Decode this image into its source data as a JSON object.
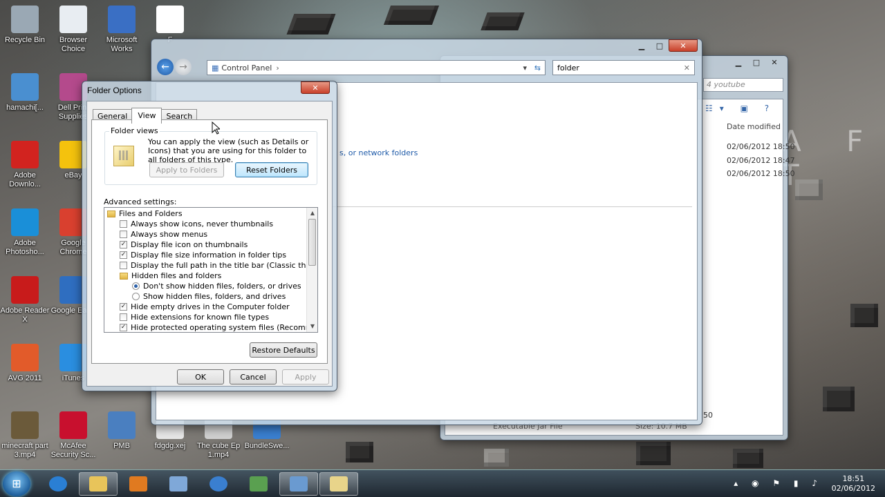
{
  "desktop_icons": [
    {
      "label": "Recycle Bin",
      "icon": "recycle-bin-icon",
      "color": "#9aa8b4"
    },
    {
      "label": "Browser Choice",
      "icon": "checklist-icon",
      "color": "#e8edf2"
    },
    {
      "label": "Microsoft Works",
      "icon": "works-icon",
      "color": "#3a6fc4"
    },
    {
      "label": "F",
      "icon": "panda-icon",
      "color": "#ffffff"
    },
    {
      "label": "hamachi[...",
      "icon": "hamachi-icon",
      "color": "#4a8fd0"
    },
    {
      "label": "Dell Print Supplies",
      "icon": "printer-icon",
      "color": "#b44a8c"
    },
    {
      "label": "Adobe Downlo...",
      "icon": "adobe-icon",
      "color": "#d2231f"
    },
    {
      "label": "eBay",
      "icon": "ebay-icon",
      "color": "#f4c20d"
    },
    {
      "label": "Adobe Photosho...",
      "icon": "photoshop-elements-icon",
      "color": "#1a8fd8"
    },
    {
      "label": "Google Chrome",
      "icon": "chrome-icon",
      "color": "#d9402f"
    },
    {
      "label": "Adobe Reader X",
      "icon": "acrobat-icon",
      "color": "#c81b1b"
    },
    {
      "label": "Google Earth",
      "icon": "earth-icon",
      "color": "#2f6ec0"
    },
    {
      "label": "AVG 2011",
      "icon": "avg-icon",
      "color": "#e25b2a"
    },
    {
      "label": "iTunes",
      "icon": "itunes-icon",
      "color": "#2a8ee0"
    },
    {
      "label": "minecraft part 3.mp4",
      "icon": "video-icon",
      "color": "#6b5a3a"
    },
    {
      "label": "McAfee Security Sc...",
      "icon": "mcafee-icon",
      "color": "#c8102e"
    },
    {
      "label": "PMB",
      "icon": "pmb-icon",
      "color": "#4a7fc0"
    },
    {
      "label": "fdgdg.xej",
      "icon": "xel-file-icon",
      "color": "#e7e7e7"
    },
    {
      "label": "The cube Ep 1.mp4",
      "icon": "video-icon",
      "color": "#d0d0d0"
    },
    {
      "label": "BundleSwe...",
      "icon": "bundle-icon",
      "color": "#3a7fd0"
    }
  ],
  "wallpaper_text": "A F T",
  "control_panel": {
    "breadcrumb": "Control Panel",
    "search_value": "folder",
    "link_text": "s, or network folders"
  },
  "bg_window": {
    "search_placeholder": "4 youtube",
    "column_header": "Date modified",
    "dates": [
      "02/06/2012 18:50",
      "02/06/2012 18:47",
      "02/06/2012 18:50"
    ],
    "status_fragment": "50",
    "bottom_row": "Executable Jar File",
    "bottom_size": "Size: 10.7 MB"
  },
  "folder_options": {
    "title": "Folder Options",
    "tabs": [
      "General",
      "View",
      "Search"
    ],
    "active_tab": "View",
    "folder_views_label": "Folder views",
    "folder_views_text": "You can apply the view (such as Details or Icons) that you are using for this folder to all folders of this type.",
    "apply_to_folders": "Apply to Folders",
    "reset_folders": "Reset Folders",
    "advanced_label": "Advanced settings:",
    "items": [
      {
        "type": "folder",
        "label": "Files and Folders",
        "indent": 0
      },
      {
        "type": "check",
        "label": "Always show icons, never thumbnails",
        "checked": false,
        "indent": 1
      },
      {
        "type": "check",
        "label": "Always show menus",
        "checked": false,
        "indent": 1
      },
      {
        "type": "check",
        "label": "Display file icon on thumbnails",
        "checked": true,
        "indent": 1
      },
      {
        "type": "check",
        "label": "Display file size information in folder tips",
        "checked": true,
        "indent": 1
      },
      {
        "type": "check",
        "label": "Display the full path in the title bar (Classic theme only)",
        "checked": false,
        "indent": 1
      },
      {
        "type": "folder",
        "label": "Hidden files and folders",
        "indent": 1
      },
      {
        "type": "radio",
        "label": "Don't show hidden files, folders, or drives",
        "checked": true,
        "indent": 2
      },
      {
        "type": "radio",
        "label": "Show hidden files, folders, and drives",
        "checked": false,
        "indent": 2
      },
      {
        "type": "check",
        "label": "Hide empty drives in the Computer folder",
        "checked": true,
        "indent": 1
      },
      {
        "type": "check",
        "label": "Hide extensions for known file types",
        "checked": false,
        "indent": 1
      },
      {
        "type": "check",
        "label": "Hide protected operating system files (Recommended)",
        "checked": true,
        "indent": 1
      }
    ],
    "restore_defaults": "Restore Defaults",
    "ok": "OK",
    "cancel": "Cancel",
    "apply": "Apply"
  },
  "taskbar": {
    "time": "18:51",
    "date": "02/06/2012"
  }
}
